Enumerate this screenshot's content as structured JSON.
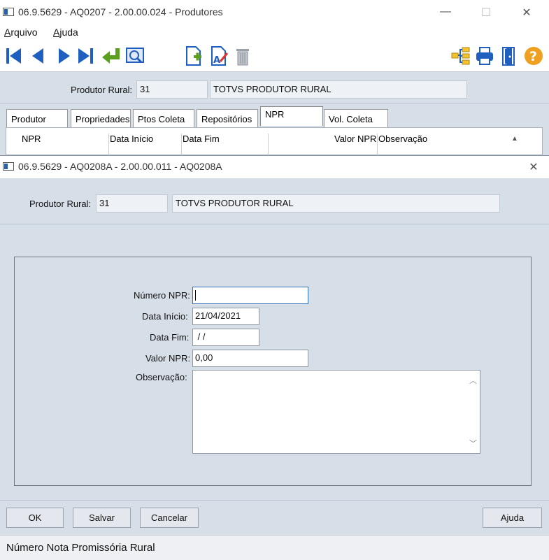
{
  "back_window": {
    "title": "06.9.5629 - AQ0207 - 2.00.00.024 - Produtores",
    "controls": {
      "minimize": "—",
      "maximize": "☐",
      "close": "✕"
    },
    "menu": [
      {
        "label": "Arquivo",
        "accel": "A",
        "rest": "rquivo"
      },
      {
        "label": "Ajuda",
        "accel": "A",
        "rest": "juda"
      }
    ],
    "toolbar_icons": [
      "first-record-icon",
      "previous-record-icon",
      "next-record-icon",
      "last-record-icon",
      "goto-enter-icon",
      "zoom-search-icon",
      "new-record-icon",
      "edit-record-icon",
      "delete-trash-icon",
      "tree-structure-icon",
      "print-icon",
      "exit-door-icon",
      "help-icon"
    ],
    "produtor_label": "Produtor Rural:",
    "produtor_code": "31",
    "produtor_name": "TOTVS PRODUTOR RURAL",
    "tabs": [
      "Produtor",
      "Propriedades",
      "Ptos Coleta",
      "Repositórios",
      "NPR",
      "Vol. Coleta"
    ],
    "active_tab": "NPR",
    "grid_columns": [
      "NPR",
      "Data Início",
      "Data Fim",
      "Valor NPR",
      "Observação"
    ],
    "scroll_up": "▲"
  },
  "dialog": {
    "title": "06.9.5629 - AQ0208A - 2.00.00.011 - AQ0208A",
    "close": "✕",
    "produtor_label": "Produtor Rural:",
    "produtor_code": "31",
    "produtor_name": "TOTVS PRODUTOR RURAL",
    "fields": {
      "numero_npr_label": "Número NPR:",
      "numero_npr_value": "",
      "data_inicio_label": "Data Início:",
      "data_inicio_value": "21/04/2021",
      "data_fim_label": "Data Fim:",
      "data_fim_value": " / /",
      "valor_npr_label": "Valor NPR:",
      "valor_npr_value": "0,00",
      "observacao_label": "Observação:",
      "observacao_value": ""
    },
    "buttons": {
      "ok": "OK",
      "salvar": "Salvar",
      "cancelar": "Cancelar",
      "ajuda": "Ajuda"
    },
    "status_text": "Número Nota Promissória Rural"
  },
  "colors": {
    "panel_bg": "#d6dee8",
    "toolbar_blue": "#1f5fbf",
    "toolbar_green": "#5aa01e",
    "help_orange": "#f0a020",
    "focus_border": "#2f6fb7"
  }
}
